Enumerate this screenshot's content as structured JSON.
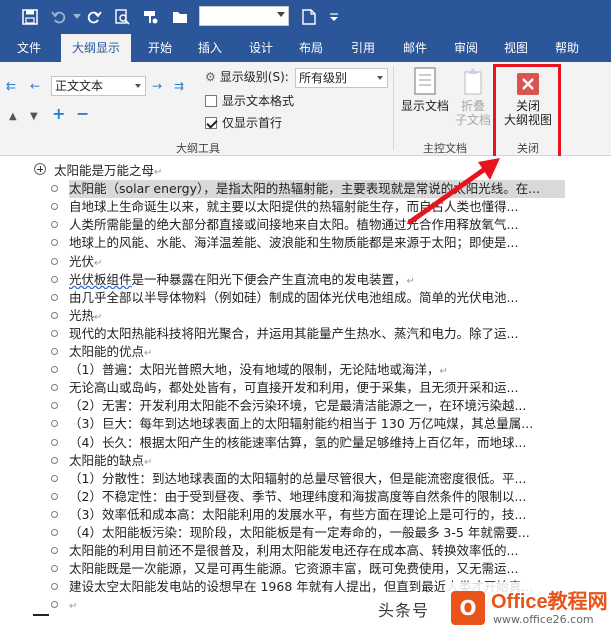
{
  "qat": {
    "save_icon": "save-icon",
    "undo_icon": "undo-icon",
    "redo_icon": "redo-icon",
    "print_preview_icon": "print-preview-icon",
    "format_painter_icon": "format-painter-icon",
    "folder_icon": "folder-icon",
    "new_doc_icon": "new-document-icon",
    "font_box_value": ""
  },
  "tabs": [
    {
      "label": "文件"
    },
    {
      "label": "大纲显示"
    },
    {
      "label": "开始"
    },
    {
      "label": "插入"
    },
    {
      "label": "设计"
    },
    {
      "label": "布局"
    },
    {
      "label": "引用"
    },
    {
      "label": "邮件"
    },
    {
      "label": "审阅"
    },
    {
      "label": "视图"
    },
    {
      "label": "帮助"
    }
  ],
  "ribbon": {
    "outline_tools": {
      "level_value": "正文文本",
      "show_level_label": "显示级别(S):",
      "show_level_value": "所有级别",
      "show_text_format": "显示文本格式",
      "first_line_only": "仅显示首行",
      "group_label": "大纲工具"
    },
    "master_doc": {
      "show_document": "显示文档",
      "collapse_line1": "折叠",
      "collapse_line2": "子文档",
      "group_label": "主控文档"
    },
    "close": {
      "line1": "关闭",
      "line2": "大纲视图",
      "group_label": "关闭"
    }
  },
  "document": {
    "lines": [
      {
        "text": "太阳能是万能之母",
        "type": "h1",
        "mark": "↵"
      },
      {
        "text": "太阳能（solar energy），是指太阳的热辐射能，主要表现就是常说的太阳光线。在...",
        "type": "body",
        "highlight": true
      },
      {
        "text": "自地球上生命诞生以来，就主要以太阳提供的热辐射能生存，而自古人类也懂得...",
        "type": "body"
      },
      {
        "text": "人类所需能量的绝大部分都直接或间接地来自太阳。植物通过光合作用释放氧气...",
        "type": "body"
      },
      {
        "text": "地球上的风能、水能、海洋温差能、波浪能和生物质能都是来源于太阳；即使是...",
        "type": "body"
      },
      {
        "text": "光伏",
        "type": "body",
        "mark": "↵"
      },
      {
        "text": "光伏板组件是一种暴露在阳光下便会产生直流电的发电装置，",
        "type": "body",
        "mark": "↵",
        "underline": "光伏板组件"
      },
      {
        "text": "由几乎全部以半导体物料（例如硅）制成的固体光伏电池组成。简单的光伏电池...",
        "type": "body"
      },
      {
        "text": "光热",
        "type": "body",
        "mark": "↵"
      },
      {
        "text": "现代的太阳热能科技将阳光聚合，并运用其能量产生热水、蒸汽和电力。除了运...",
        "type": "body"
      },
      {
        "text": "太阳能的优点",
        "type": "body",
        "mark": "↵"
      },
      {
        "text": "（1）普遍：太阳光普照大地，没有地域的限制，无论陆地或海洋，",
        "type": "body",
        "mark": "↵"
      },
      {
        "text": "无论高山或岛屿，都处处皆有，可直接开发和利用，便于采集，且无须开采和运...",
        "type": "body"
      },
      {
        "text": "（2）无害：开发利用太阳能不会污染环境，它是最清洁能源之一，在环境污染越...",
        "type": "body"
      },
      {
        "text": "（3）巨大：每年到达地球表面上的太阳辐射能约相当于 130 万亿吨煤，其总量属...",
        "type": "body"
      },
      {
        "text": "（4）长久：根据太阳产生的核能速率估算，氢的贮量足够维持上百亿年，而地球...",
        "type": "body"
      },
      {
        "text": "太阳能的缺点",
        "type": "body",
        "mark": "↵"
      },
      {
        "text": "（1）分散性：到达地球表面的太阳辐射的总量尽管很大，但是能流密度很低。平...",
        "type": "body"
      },
      {
        "text": "（2）不稳定性：由于受到昼夜、季节、地理纬度和海拔高度等自然条件的限制以...",
        "type": "body"
      },
      {
        "text": "（3）效率低和成本高：太阳能利用的发展水平，有些方面在理论上是可行的，技...",
        "type": "body"
      },
      {
        "text": "（4）太阳能板污染：现阶段，太阳能板是有一定寿命的，一般最多 3-5 年就需要...",
        "type": "body"
      },
      {
        "text": "太阳能的利用目前还不是很普及，利用太阳能发电还存在成本高、转换效率低的...",
        "type": "body"
      },
      {
        "text": "太阳能既是一次能源，又是可再生能源。它资源丰富，既可免费使用，又无需运...",
        "type": "body"
      },
      {
        "text": "建设太空太阳能发电站的设想早在 1968 年就有人提出，但直到最近人类才开始真...",
        "type": "body"
      },
      {
        "text": "",
        "type": "body",
        "mark": "↵"
      }
    ]
  },
  "watermark": {
    "text": "头条号",
    "badge": "O",
    "brand": "Office教程网",
    "url": "www.office26.com"
  },
  "colors": {
    "accent": "#2b579a",
    "annotation": "#e8141c",
    "close_button": "#d9534f",
    "brand": "#e8541a"
  }
}
